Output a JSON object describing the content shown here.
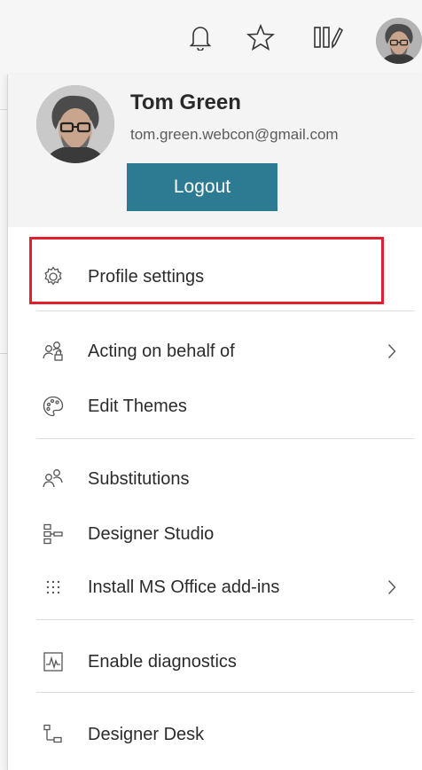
{
  "user": {
    "name": "Tom Green",
    "email": "tom.green.webcon@gmail.com",
    "logout_label": "Logout"
  },
  "menu": {
    "items": [
      {
        "label": "Profile settings",
        "icon": "gear-icon",
        "has_submenu": false
      },
      {
        "label": "Acting on behalf of",
        "icon": "users-lock-icon",
        "has_submenu": true
      },
      {
        "label": "Edit Themes",
        "icon": "palette-icon",
        "has_submenu": false
      },
      {
        "label": "Substitutions",
        "icon": "users-icon",
        "has_submenu": false
      },
      {
        "label": "Designer Studio",
        "icon": "hierarchy-icon",
        "has_submenu": false
      },
      {
        "label": "Install MS Office add-ins",
        "icon": "grid-dots-icon",
        "has_submenu": true
      },
      {
        "label": "Enable diagnostics",
        "icon": "activity-chart-icon",
        "has_submenu": false
      },
      {
        "label": "Designer Desk",
        "icon": "flow-icon",
        "has_submenu": false
      }
    ]
  },
  "colors": {
    "logout_button": "#2d7a93",
    "highlight_border": "#e0202d",
    "header_background": "#f4f4f4"
  }
}
